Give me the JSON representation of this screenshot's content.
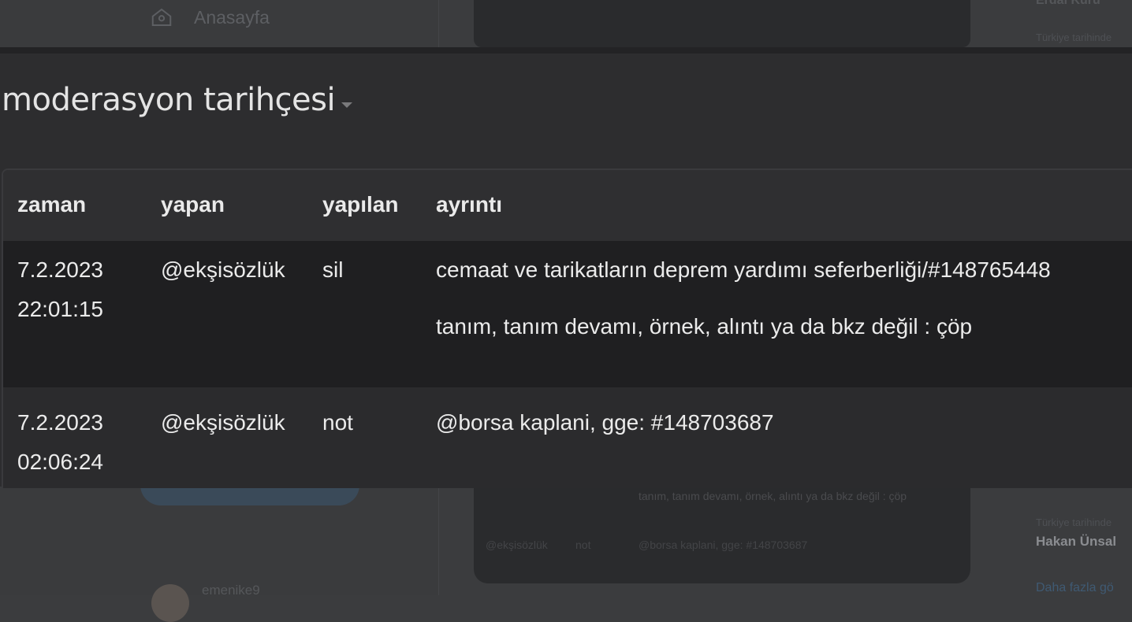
{
  "background": {
    "nav_home_label": "Anasayfa",
    "mini_detail_line": "tanım, tanım devamı, örnek, alıntı ya da bkz değil : çöp",
    "mini_row": {
      "user": "@ekşisözlük",
      "action": "not",
      "detail": "@borsa kaplani, gge: #148703687"
    },
    "username_partial": "emenike9",
    "right_top": "Erdal Kuru",
    "right_small_1": "Türkiye tarihinde",
    "right_small_2": "Türkiye tarihinde",
    "right_name": "Hakan Ünsal",
    "right_link": "Daha fazla gö"
  },
  "modal": {
    "title": "moderasyon tarihçesi",
    "columns": [
      "zaman",
      "yapan",
      "yapılan",
      "ayrıntı"
    ],
    "rows": [
      {
        "date": "7.2.2023",
        "time": "22:01:15",
        "user": "@ekşisözlük",
        "action": "sil",
        "detail_line1": "cemaat ve tarikatların deprem yardımı seferberliği/#148765448",
        "detail_line2": "tanım, tanım devamı, örnek, alıntı ya da bkz değil : çöp"
      },
      {
        "date": "7.2.2023",
        "time": "02:06:24",
        "user": "@ekşisözlük",
        "action": "not",
        "detail_line1": "@borsa kaplani, gge: #148703687"
      }
    ]
  },
  "colors": {
    "modal_bg": "#2d2d2f",
    "row_highlight": "#1f1f21",
    "text": "#ebebeb"
  }
}
